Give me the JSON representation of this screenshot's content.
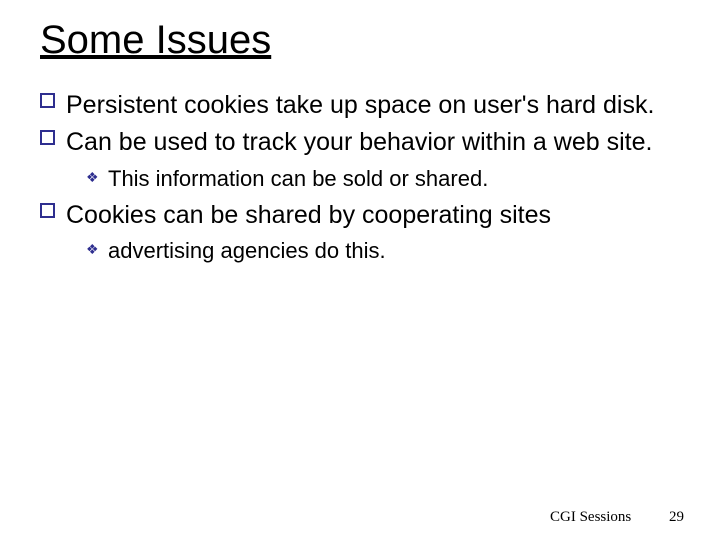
{
  "title": "Some Issues",
  "bullets": {
    "b1": "Persistent cookies take up space on user's hard disk.",
    "b2": "Can be used to track your behavior within a web site.",
    "b2_1": "This information can be sold or shared.",
    "b3": "Cookies can be shared by cooperating sites",
    "b3_1": "advertising agencies do this."
  },
  "footer": {
    "label": "CGI Sessions",
    "page": "29"
  }
}
